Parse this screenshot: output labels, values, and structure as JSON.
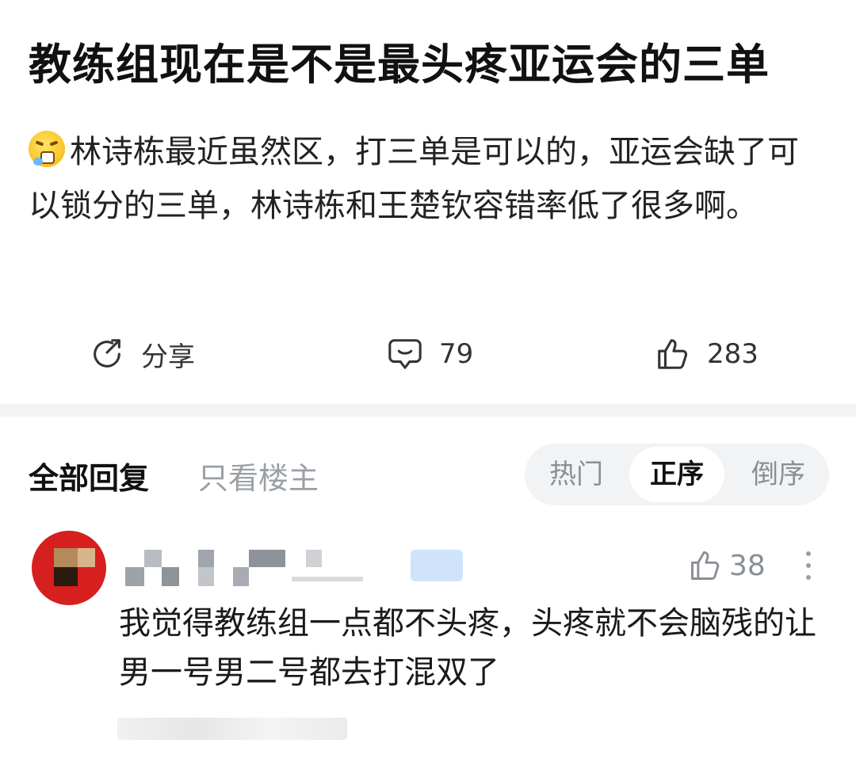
{
  "post": {
    "title": "教练组现在是不是最头疼亚运会的三单",
    "body": "林诗栋最近虽然区，打三单是可以的，亚运会缺了可以锁分的三单，林诗栋和王楚钦容错率低了很多啊。",
    "emoji_icon": "sneezing-face-emoji"
  },
  "actions": {
    "share_label": "分享",
    "comment_count": "79",
    "like_count": "283"
  },
  "reply_tabs": {
    "all": "全部回复",
    "op_only": "只看楼主"
  },
  "sort": {
    "hot": "热门",
    "ascending": "正序",
    "descending": "倒序",
    "selected": "正序"
  },
  "comments": [
    {
      "text": "我觉得教练组一点都不头疼，头疼就不会脑残的让男一号男二号都去打混双了",
      "likes": "38"
    }
  ],
  "colors": {
    "accent_text": "#111111",
    "muted": "#9aa0a6",
    "divider": "#f3f4f6",
    "segment_bg": "#f2f3f5",
    "avatar": "#d61f1f"
  }
}
